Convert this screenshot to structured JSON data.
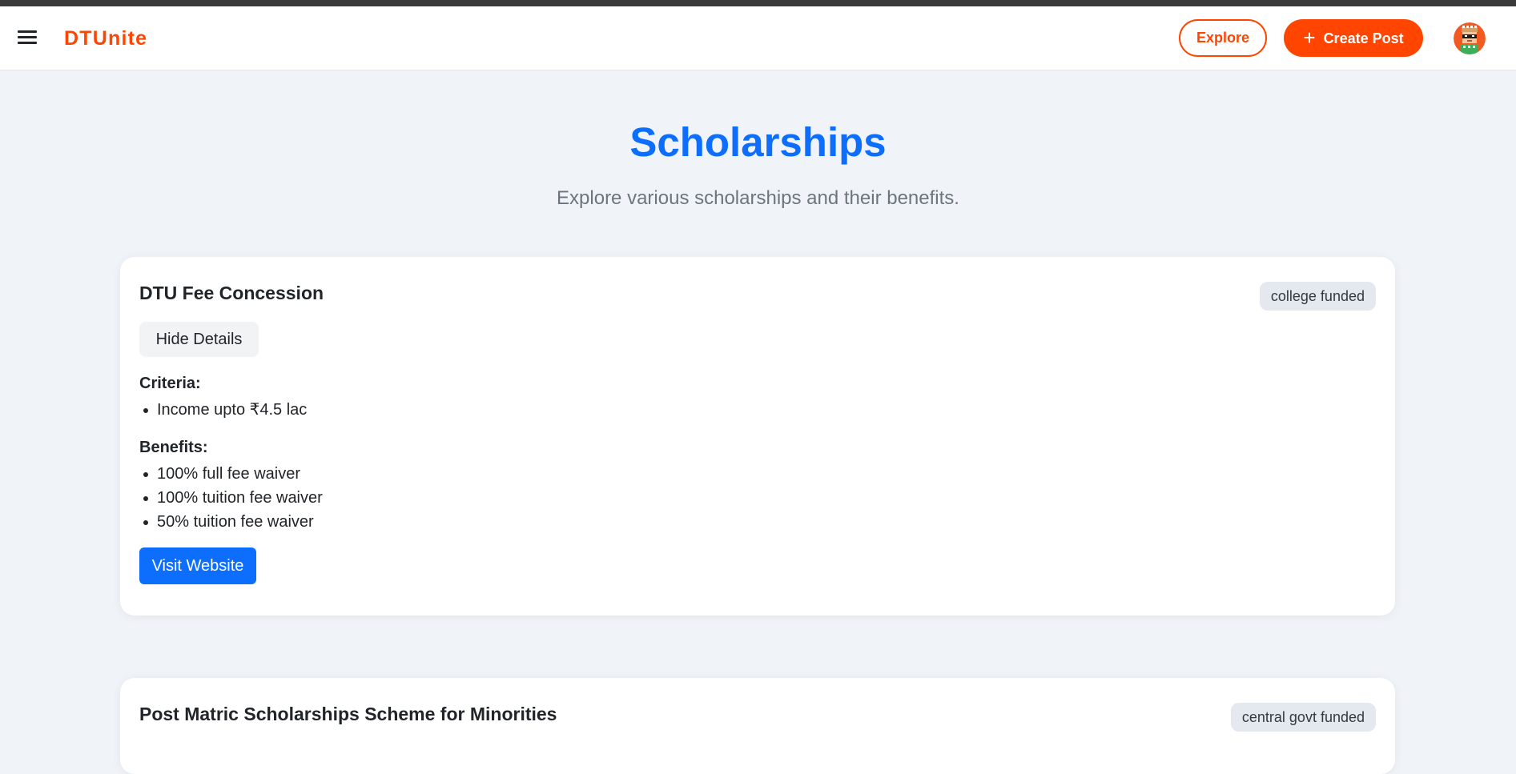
{
  "navbar": {
    "brand": "DTUnite",
    "explore_label": "Explore",
    "create_post_label": "Create Post"
  },
  "page": {
    "title": "Scholarships",
    "subtitle": "Explore various scholarships and their benefits."
  },
  "scholarships": [
    {
      "title": "DTU Fee Concession",
      "badge": "college funded",
      "toggle_label": "Hide Details",
      "criteria_label": "Criteria:",
      "criteria": [
        "Income upto ₹4.5 lac"
      ],
      "benefits_label": "Benefits:",
      "benefits": [
        "100% full fee waiver",
        "100% tuition fee waiver",
        "50% tuition fee waiver"
      ],
      "visit_label": "Visit Website"
    },
    {
      "title": "Post Matric Scholarships Scheme for Minorities",
      "badge": "central govt funded"
    }
  ],
  "colors": {
    "brand": "#ff4500",
    "primary": "#0d6efd",
    "background": "#f0f3f7"
  },
  "icons": {
    "menu": "hamburger-menu-icon",
    "create": "plus-icon",
    "avatar": "pixel-avatar"
  }
}
